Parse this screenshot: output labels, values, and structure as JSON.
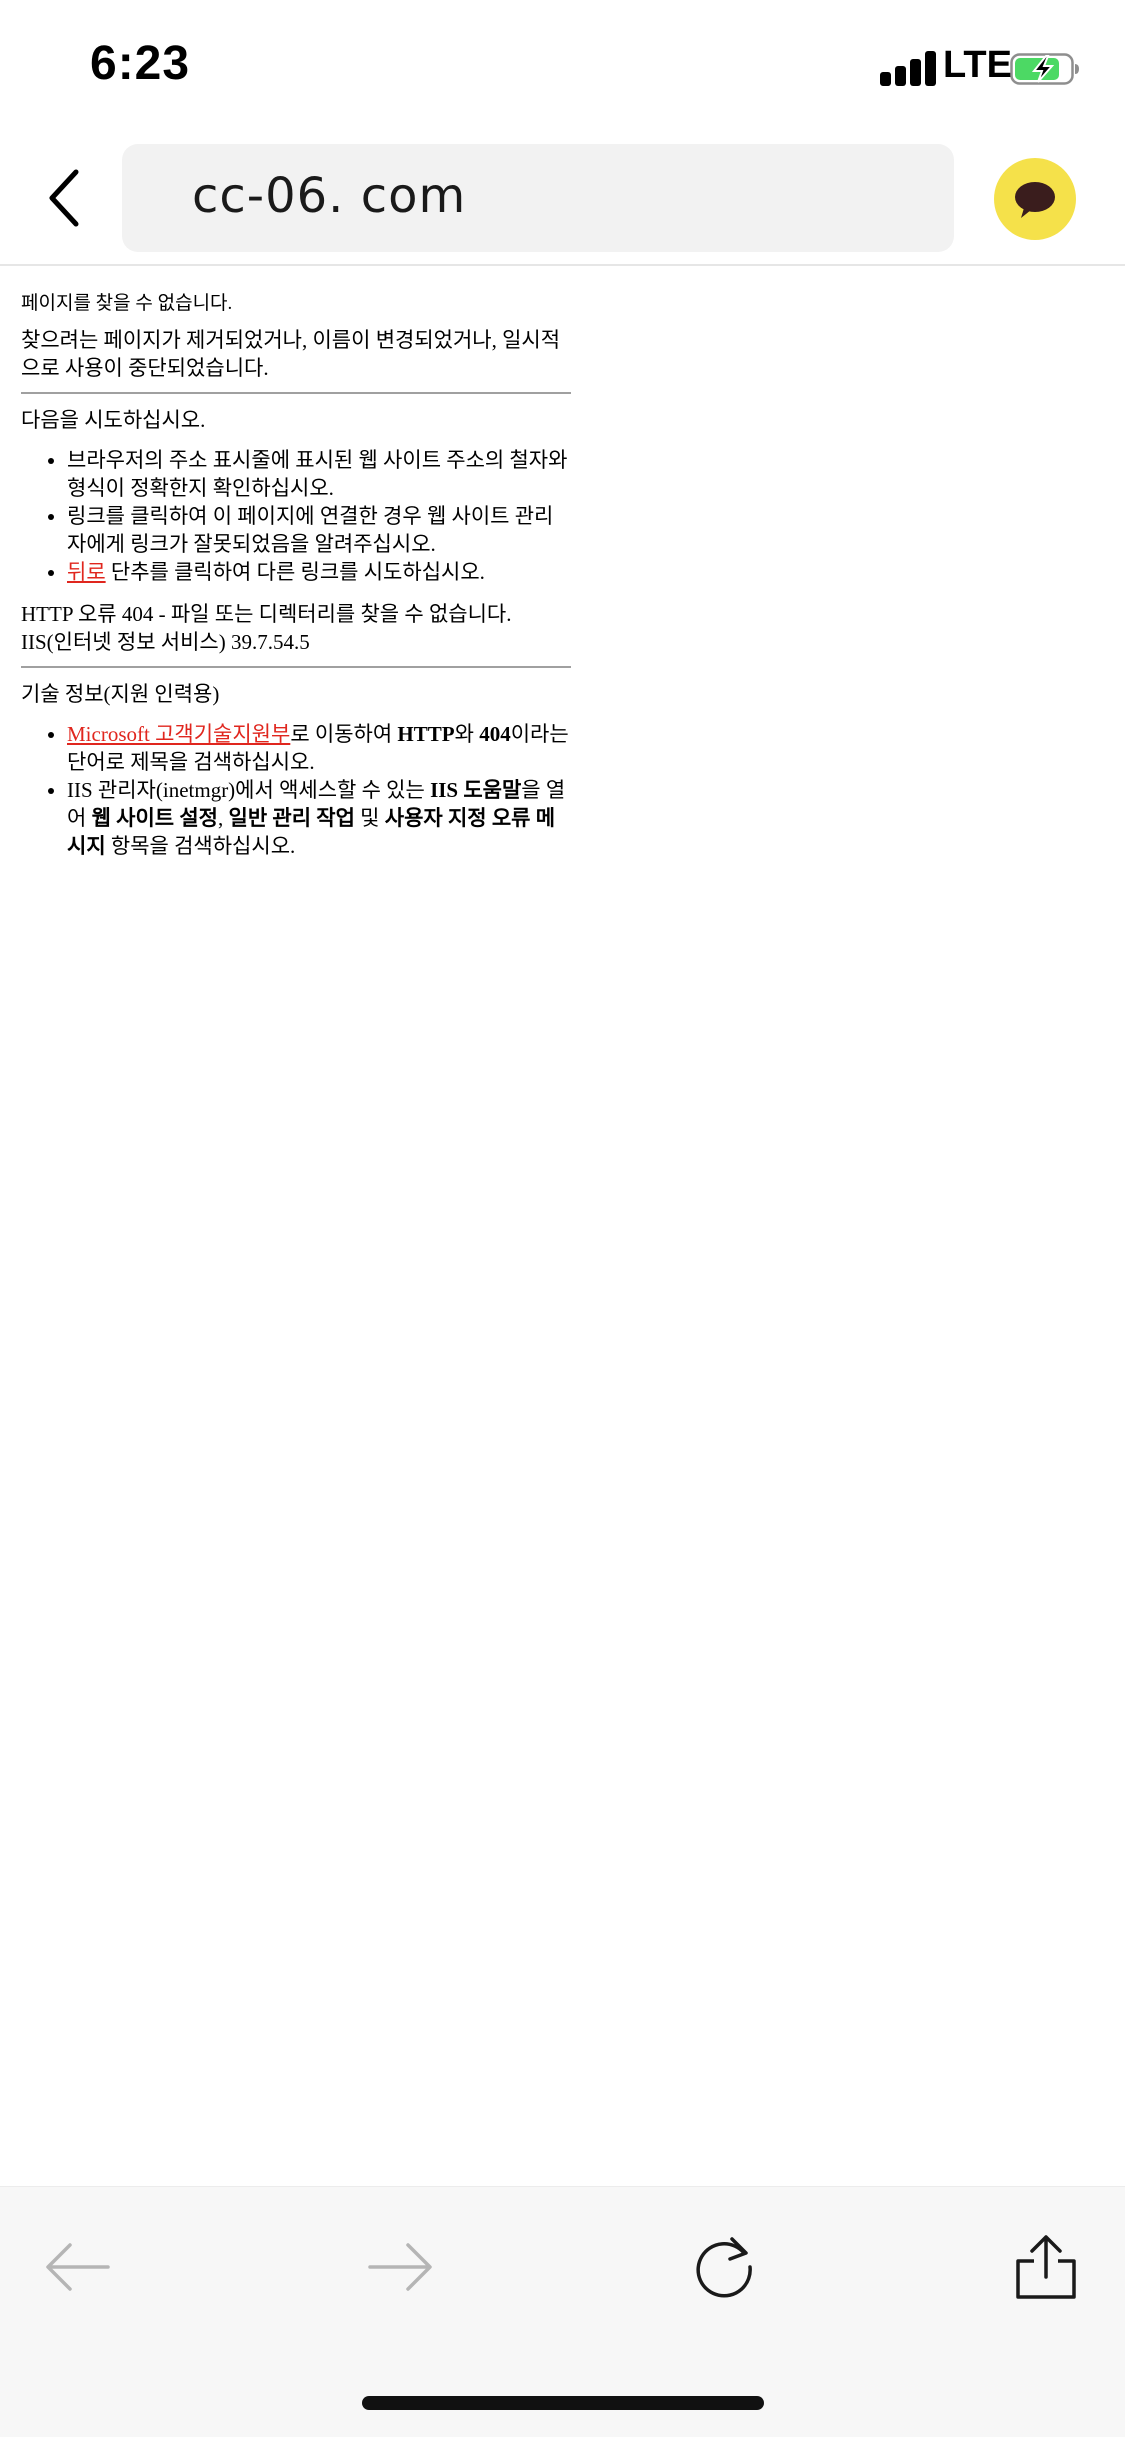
{
  "status_bar": {
    "time": "6:23",
    "network": "LTE",
    "battery_state": "charging"
  },
  "address_bar": {
    "url": "cc-06. com",
    "back_icon": "chevron-left-icon",
    "talk_icon": "speech-bubble-icon",
    "talk_color": "#f5e14a"
  },
  "page": {
    "title": "페이지를 찾을 수 없습니다.",
    "description": "찾으려는 페이지가 제거되었거나, 이름이 변경되었거나, 일시적으로 사용이 중단되었습니다.",
    "try_heading": "다음을 시도하십시오.",
    "tips": {
      "item1": "브라우저의 주소 표시줄에 표시된 웹 사이트 주소의 철자와 형식이 정확한지 확인하십시오.",
      "item2": "링크를 클릭하여 이 페이지에 연결한 경우 웹 사이트 관리자에게 링크가 잘못되었음을 알려주십시오.",
      "item3_link": "뒤로",
      "item3_rest": " 단추를 클릭하여 다른 링크를 시도하십시오."
    },
    "error_code_line": "HTTP 오류 404 - 파일 또는 디렉터리를 찾을 수 없습니다.",
    "server_line": "IIS(인터넷 정보 서비스) 39.7.54.5",
    "tech_heading": "기술 정보(지원 인력용)",
    "tech": {
      "item1_link": "Microsoft 고객기술지원부",
      "item1_a": "로 이동하여 ",
      "item1_b1": "HTTP",
      "item1_c": "와 ",
      "item1_b2": "404",
      "item1_d": "이라는 단어로 제목을 검색하십시오.",
      "item2_a": "IIS 관리자(inetmgr)에서 액세스할 수 있는 ",
      "item2_b1": "IIS 도움말",
      "item2_c": "을 열어 ",
      "item2_b2": "웹 사이트 설정",
      "item2_d": ", ",
      "item2_b3": "일반 관리 작업",
      "item2_e": " 및 ",
      "item2_b4": "사용자 지정 오류 메시지",
      "item2_f": " 항목을 검색하십시오."
    },
    "link_color": "#e0261e"
  },
  "toolbar": {
    "icons": [
      "arrow-left-icon",
      "arrow-right-icon",
      "reload-icon",
      "share-icon"
    ]
  }
}
